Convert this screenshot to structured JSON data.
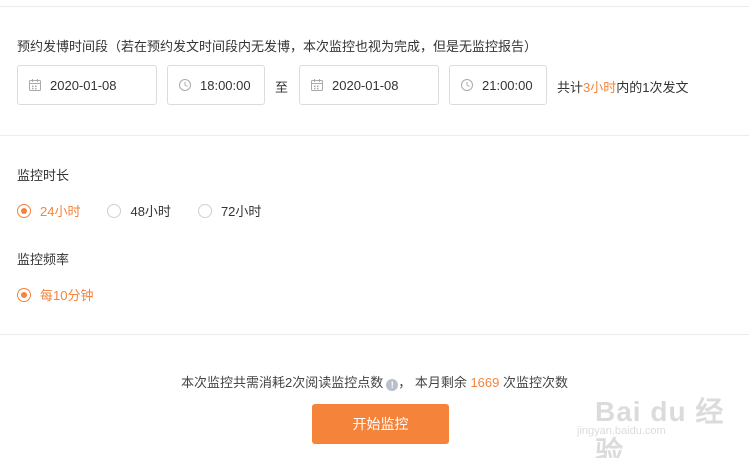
{
  "schedule": {
    "label": "预约发博时间段（若在预约发文时间段内无发博，本次监控也视为完成，但是无监控报告）",
    "start_date": "2020-01-08",
    "start_time": "18:00:00",
    "separator": "至",
    "end_date": "2020-01-08",
    "end_time": "21:00:00",
    "total_prefix": "共计",
    "total_hours": "3小时",
    "total_suffix": "内的1次发文"
  },
  "duration": {
    "label": "监控时长",
    "options": [
      {
        "label": "24小时",
        "checked": true
      },
      {
        "label": "48小时",
        "checked": false
      },
      {
        "label": "72小时",
        "checked": false
      }
    ]
  },
  "frequency": {
    "label": "监控频率",
    "options": [
      {
        "label": "每10分钟",
        "checked": true
      }
    ]
  },
  "cost": {
    "text": "本次监控共需消耗2次阅读监控点数",
    "info_glyph": "!",
    "remaining_prefix": "， 本月剩余",
    "remaining_count": "1669",
    "remaining_suffix": "次监控次数"
  },
  "start_button": {
    "label": "开始监控"
  },
  "watermark": {
    "brand": "Bai du 经验",
    "url": "jingyan.baidu.com"
  },
  "colors": {
    "accent": "#f5833a",
    "border": "#dcdcdc"
  },
  "icons": {
    "date": "calendar-icon",
    "time": "clock-icon"
  }
}
